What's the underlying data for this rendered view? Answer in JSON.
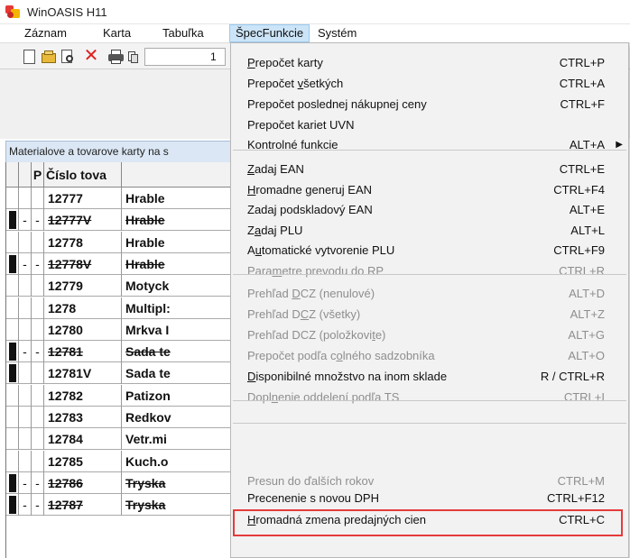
{
  "window": {
    "title": "WinOASIS H11"
  },
  "menubar": {
    "items": [
      {
        "label": "Záznam",
        "active": false
      },
      {
        "label": "Karta",
        "active": false
      },
      {
        "label": "Tabuľka",
        "active": false
      },
      {
        "label": "ŠpecFunkcie",
        "active": true
      },
      {
        "label": "Systém",
        "active": false
      }
    ]
  },
  "toolbar": {
    "icons": [
      "new-document-icon",
      "open-folder-icon",
      "print-preview-icon",
      "delete-icon",
      "printer-icon",
      "copy-icon"
    ],
    "field_value": "1"
  },
  "panel": {
    "caption": "Materialove a tovarove karty na s"
  },
  "grid": {
    "header": {
      "p": "P",
      "number": "Číslo tova"
    },
    "rows": [
      {
        "mark": false,
        "d": "",
        "p": "",
        "number": "12777",
        "name": "Hrable",
        "strike": false
      },
      {
        "mark": true,
        "d": "-",
        "p": "-",
        "number": "12777V",
        "name": "Hrable",
        "strike": true
      },
      {
        "mark": false,
        "d": "",
        "p": "",
        "number": "12778",
        "name": "Hrable",
        "strike": false
      },
      {
        "mark": true,
        "d": "-",
        "p": "-",
        "number": "12778V",
        "name": "Hrable",
        "strike": true
      },
      {
        "mark": false,
        "d": "",
        "p": "",
        "number": "12779",
        "name": "Motyck",
        "strike": false
      },
      {
        "mark": false,
        "d": "",
        "p": "",
        "number": "1278",
        "name": "Multipl:",
        "strike": false
      },
      {
        "mark": false,
        "d": "",
        "p": "",
        "number": "12780",
        "name": "Mrkva I",
        "strike": false
      },
      {
        "mark": true,
        "d": "-",
        "p": "-",
        "number": "12781",
        "name": "Sada te",
        "strike": true
      },
      {
        "mark": true,
        "d": "",
        "p": "",
        "number": "12781V",
        "name": "Sada te",
        "strike": false
      },
      {
        "mark": false,
        "d": "",
        "p": "",
        "number": "12782",
        "name": "Patizon",
        "strike": false
      },
      {
        "mark": false,
        "d": "",
        "p": "",
        "number": "12783",
        "name": "Redkov",
        "strike": false
      },
      {
        "mark": false,
        "d": "",
        "p": "",
        "number": "12784",
        "name": "Vetr.mi",
        "strike": false
      },
      {
        "mark": false,
        "d": "",
        "p": "",
        "number": "12785",
        "name": "Kuch.o",
        "strike": false
      },
      {
        "mark": true,
        "d": "-",
        "p": "-",
        "number": "12786",
        "name": "Tryska",
        "strike": true
      },
      {
        "mark": true,
        "d": "-",
        "p": "-",
        "number": "12787",
        "name": "Tryska",
        "strike": true
      }
    ]
  },
  "dropdown": {
    "items": [
      {
        "pre": "",
        "u": "P",
        "post": "repočet karty",
        "shortcut": "CTRL+P",
        "disabled": false,
        "submenu": false,
        "sep_before": false
      },
      {
        "pre": "Prepočet ",
        "u": "v",
        "post": "šetkých",
        "shortcut": "CTRL+A",
        "disabled": false,
        "submenu": false,
        "sep_before": false
      },
      {
        "pre": "Prepočet poslednej nákupnej ceny",
        "u": "",
        "post": "",
        "shortcut": "CTRL+F",
        "disabled": false,
        "submenu": false,
        "sep_before": false
      },
      {
        "pre": "Prepočet kariet UVN",
        "u": "",
        "post": "",
        "shortcut": "",
        "disabled": false,
        "submenu": false,
        "sep_before": false
      },
      {
        "pre": "Kontrolné ",
        "u": "f",
        "post": "unkcie",
        "shortcut": "ALT+A",
        "disabled": false,
        "submenu": true,
        "sep_before": false
      },
      {
        "pre": "",
        "u": "Z",
        "post": "adaj EAN",
        "shortcut": "CTRL+E",
        "disabled": false,
        "submenu": false,
        "sep_before": true
      },
      {
        "pre": "",
        "u": "H",
        "post": "romadne generuj  EAN",
        "shortcut": "CTRL+F4",
        "disabled": false,
        "submenu": false,
        "sep_before": false
      },
      {
        "pre": "Zadaj podskladový EAN",
        "u": "",
        "post": "",
        "shortcut": "ALT+E",
        "disabled": false,
        "submenu": false,
        "sep_before": false
      },
      {
        "pre": "Z",
        "u": "a",
        "post": "daj PLU",
        "shortcut": "ALT+L",
        "disabled": false,
        "submenu": false,
        "sep_before": false
      },
      {
        "pre": "A",
        "u": "u",
        "post": "tomatické vytvorenie PLU",
        "shortcut": "CTRL+F9",
        "disabled": false,
        "submenu": false,
        "sep_before": false
      },
      {
        "pre": "Para",
        "u": "m",
        "post": "etre prevodu do RP",
        "shortcut": "CTRL+R",
        "disabled": true,
        "submenu": false,
        "sep_before": false
      },
      {
        "pre": "Prehľad ",
        "u": "D",
        "post": "CZ (nenulové)",
        "shortcut": "ALT+D",
        "disabled": true,
        "submenu": false,
        "sep_before": true
      },
      {
        "pre": "Prehľad D",
        "u": "C",
        "post": "Z (všetky)",
        "shortcut": "ALT+Z",
        "disabled": true,
        "submenu": false,
        "sep_before": false
      },
      {
        "pre": "Prehľad DCZ (položkovi",
        "u": "t",
        "post": "e)",
        "shortcut": "ALT+G",
        "disabled": true,
        "submenu": false,
        "sep_before": false
      },
      {
        "pre": "Prepočet podľa c",
        "u": "o",
        "post": "lného sadzobníka",
        "shortcut": "ALT+O",
        "disabled": true,
        "submenu": false,
        "sep_before": false
      },
      {
        "pre": "",
        "u": "D",
        "post": "isponibilné množstvo na inom sklade",
        "shortcut": "R / CTRL+R",
        "disabled": false,
        "submenu": false,
        "sep_before": false
      },
      {
        "pre": "Dopl",
        "u": "n",
        "post": "enie oddelení podľa TS",
        "shortcut": "CTRL+I",
        "disabled": true,
        "submenu": false,
        "sep_before": false
      },
      {
        "pre": "Presun do ďalších rokov",
        "u": "",
        "post": "",
        "shortcut": "CTRL+M",
        "disabled": true,
        "submenu": false,
        "sep_before": true
      },
      {
        "pre": "Precenenie s novou DPH",
        "u": "",
        "post": "",
        "shortcut": "CTRL+F12",
        "disabled": false,
        "submenu": false,
        "sep_before": true
      },
      {
        "pre": "",
        "u": "H",
        "post": "romadná zmena predajných cien",
        "shortcut": "CTRL+C",
        "disabled": false,
        "submenu": false,
        "sep_before": false
      }
    ]
  },
  "colors": {
    "highlight_box": "#e53b3b",
    "menu_active_bg": "#cce4f7",
    "disabled_text": "#8e8e8e",
    "delete_icon": "#e02020"
  }
}
